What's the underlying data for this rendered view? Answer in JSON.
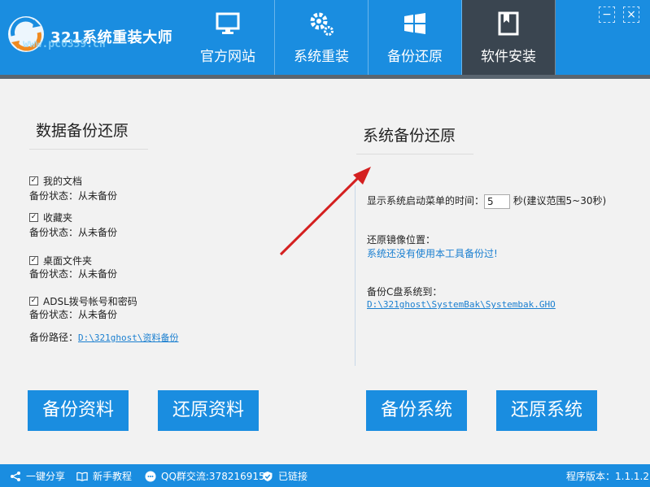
{
  "app": {
    "title": "321系统重装大师",
    "watermark": "www.pc0359.cn"
  },
  "nav": [
    {
      "label": "官方网站",
      "icon": "monitor-icon"
    },
    {
      "label": "系统重装",
      "icon": "gears-icon"
    },
    {
      "label": "备份还原",
      "icon": "windows-icon"
    },
    {
      "label": "软件安装",
      "icon": "book-icon"
    }
  ],
  "window": {
    "minimize": "−",
    "close": "×"
  },
  "data_backup": {
    "title": "数据备份还原",
    "items": [
      {
        "label": "我的文档",
        "checked": "☑",
        "status": "备份状态：从未备份"
      },
      {
        "label": "收藏夹",
        "checked": "☑",
        "status": "备份状态：从未备份"
      },
      {
        "label": "桌面文件夹",
        "checked": "☑",
        "status": "备份状态：从未备份"
      },
      {
        "label": "ADSL拨号帐号和密码",
        "checked": "☑",
        "status": "备份状态：从未备份"
      }
    ],
    "path_label": "备份路径：",
    "path_value": "D:\\321ghost\\资料备份",
    "backup_button": "备份资料",
    "restore_button": "还原资料"
  },
  "system_backup": {
    "title": "系统备份还原",
    "boot_menu_label": "显示系统启动菜单的时间：",
    "boot_menu_value": "5",
    "boot_menu_suffix": "秒(建议范围5~30秒)",
    "image_location_label": "还原镜像位置：",
    "image_location_value": "系统还没有使用本工具备份过!",
    "backup_to_label": "备份C盘系统到：",
    "backup_to_value": "D:\\321ghost\\SystemBak\\Systembak.GHO",
    "backup_button": "备份系统",
    "restore_button": "还原系统"
  },
  "footer": {
    "share": "一键分享",
    "tutorial": "新手教程",
    "qq": "QQ群交流:378216915",
    "connected": "已链接",
    "version": "程序版本：1.1.1.2"
  },
  "colors": {
    "primary": "#1a8de0",
    "active_tab": "#3a4550",
    "arrow": "#d42020"
  }
}
